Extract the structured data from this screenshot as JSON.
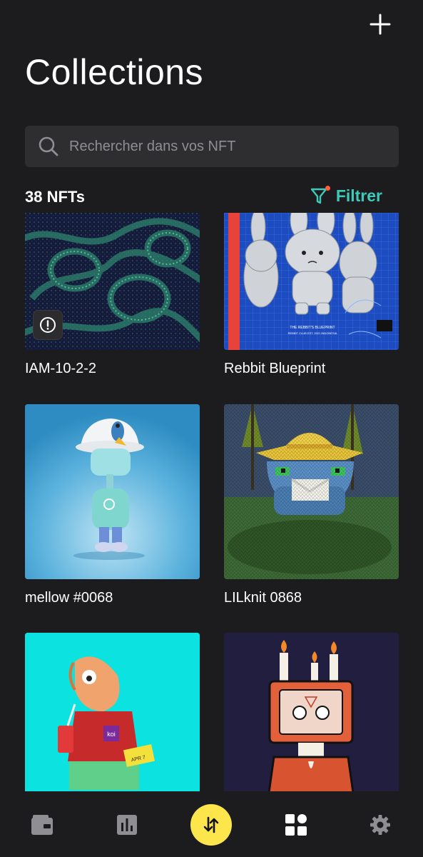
{
  "header": {
    "title": "Collections",
    "add_icon": "plus-icon"
  },
  "search": {
    "placeholder": "Rechercher dans vos NFT",
    "icon": "search-icon"
  },
  "summary": {
    "count_label": "38 NFTs",
    "filter_label": "Filtrer",
    "filter_icon": "filter-icon",
    "filter_active_color": "#ff5c40"
  },
  "nfts": [
    {
      "name": "IAM-10-2-2",
      "warning": true
    },
    {
      "name": "Rebbit Blueprint"
    },
    {
      "name": "mellow #0068"
    },
    {
      "name": "LILknit 0868"
    },
    {
      "name": ""
    },
    {
      "name": ""
    }
  ],
  "tabbar": {
    "items": [
      {
        "icon": "wallet-icon"
      },
      {
        "icon": "chart-icon"
      },
      {
        "icon": "swap-icon",
        "primary": true
      },
      {
        "icon": "nft-grid-icon",
        "active": true
      },
      {
        "icon": "settings-icon"
      }
    ]
  },
  "colors": {
    "background": "#1c1c1e",
    "accent": "#3ec9b8",
    "fab": "#fde64b",
    "input": "#2e2e31"
  }
}
